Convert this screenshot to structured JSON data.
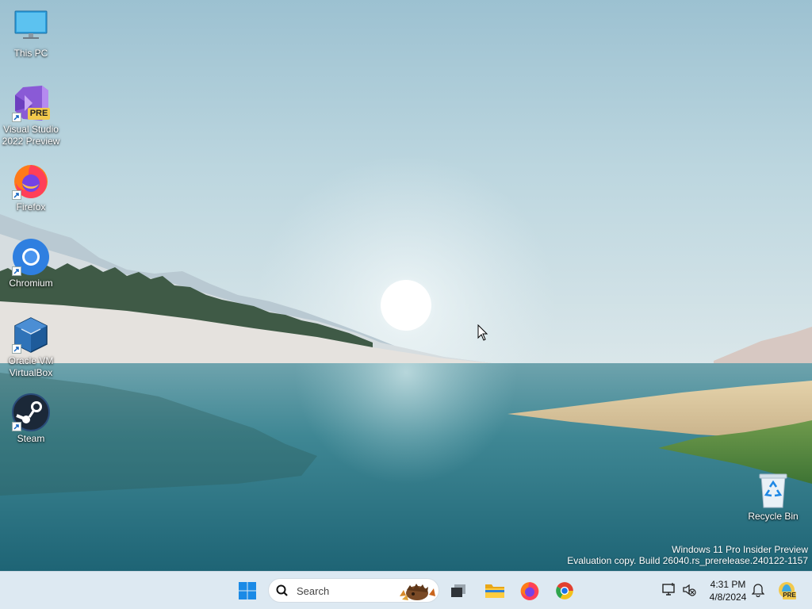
{
  "desktop": {
    "icons": [
      {
        "label": "This PC",
        "icon": "computer-icon"
      },
      {
        "label": "Visual Studio 2022 Preview",
        "icon": "visual-studio-preview-icon",
        "badge": "PRE"
      },
      {
        "label": "Firefox",
        "icon": "firefox-icon"
      },
      {
        "label": "Chromium",
        "icon": "chromium-icon"
      },
      {
        "label": "Oracle VM VirtualBox",
        "icon": "virtualbox-icon"
      },
      {
        "label": "Steam",
        "icon": "steam-icon"
      },
      {
        "label": "Recycle Bin",
        "icon": "recycle-bin-icon"
      }
    ],
    "watermark": {
      "line1": "Windows 11 Pro Insider Preview",
      "line2": "Evaluation copy. Build 26040.rs_prerelease.240122-1157"
    }
  },
  "taskbar": {
    "start_icon": "windows-start-icon",
    "search": {
      "placeholder": "Search"
    },
    "pinned": [
      {
        "name": "task-view",
        "icon": "task-view-icon"
      },
      {
        "name": "file-explorer",
        "icon": "folder-icon"
      },
      {
        "name": "firefox",
        "icon": "firefox-icon"
      },
      {
        "name": "chrome",
        "icon": "chrome-icon"
      }
    ],
    "tray": {
      "icons": [
        "network-icon",
        "volume-muted-icon"
      ],
      "time": "4:31 PM",
      "date": "4/8/2024",
      "notification_icon": "bell-icon",
      "copilot_badge": "PRE"
    }
  },
  "colors": {
    "taskbar_bg": "#dde9f2",
    "windows_blue": "#0078d4"
  }
}
